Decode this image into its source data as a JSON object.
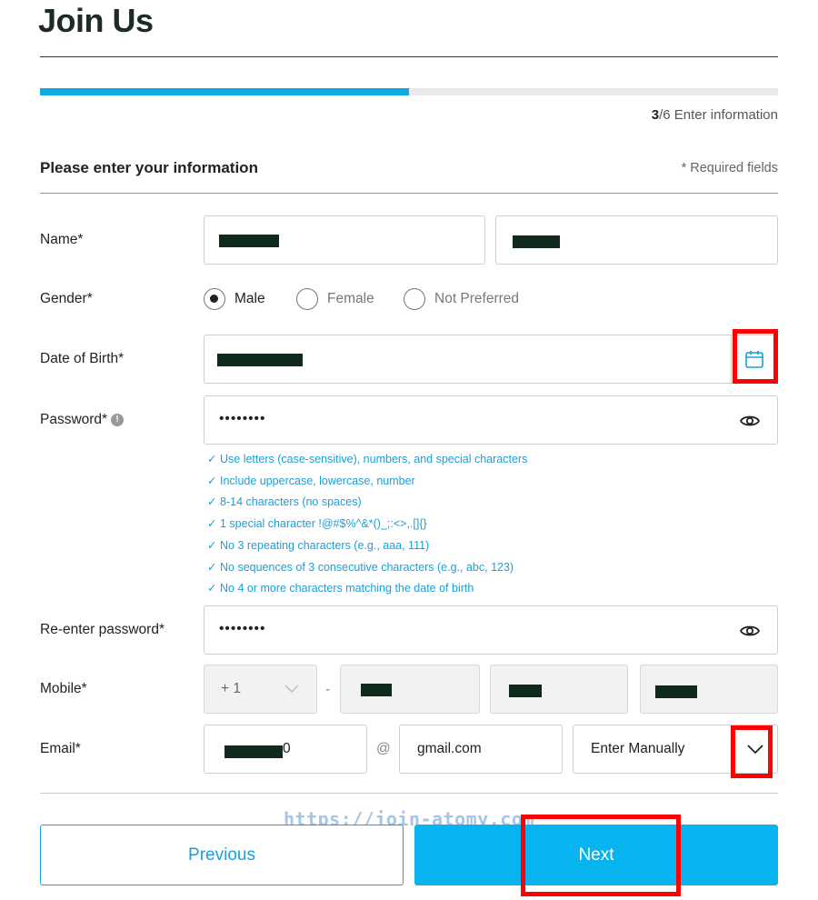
{
  "header": {
    "title": "Join Us"
  },
  "progress": {
    "fraction": 0.5,
    "step_current": "3",
    "step_total": "/6",
    "step_label": "Enter information"
  },
  "section": {
    "title": "Please enter your information",
    "required_note": "* Required fields"
  },
  "fields": {
    "name_label": "Name*",
    "gender_label": "Gender*",
    "gender_options": [
      "Male",
      "Female",
      "Not Preferred"
    ],
    "gender_selected": "Male",
    "dob_label": "Date of Birth*",
    "password_label": "Password*",
    "password_value": "••••••••",
    "reenter_label": "Re-enter password*",
    "reenter_value": "••••••••",
    "mobile_label": "Mobile*",
    "mobile_code": "+ 1",
    "mobile_sep": "-",
    "email_label": "Email*",
    "email_user_suffix": "0",
    "email_at": "@",
    "email_domain": "gmail.com",
    "email_domain_select": "Enter Manually"
  },
  "password_rules": [
    "Use letters (case-sensitive), numbers, and special characters",
    "Include uppercase, lowercase, number",
    "8-14 characters (no spaces)",
    "1 special character !@#$%^&*()_;:<>,.[]{}",
    "No 3 repeating characters (e.g., aaa, 111)",
    "No sequences of 3 consecutive characters (e.g., abc, 123)",
    "No 4 or more characters matching the date of birth"
  ],
  "buttons": {
    "previous": "Previous",
    "next": "Next"
  },
  "watermark": "https://join-atomy.com",
  "colors": {
    "accent": "#12a8e0",
    "next_bg": "#08b4ef",
    "highlight": "#ff0000"
  },
  "icons": [
    "calendar-icon",
    "eye-icon",
    "chevron-down-icon",
    "info-icon"
  ]
}
